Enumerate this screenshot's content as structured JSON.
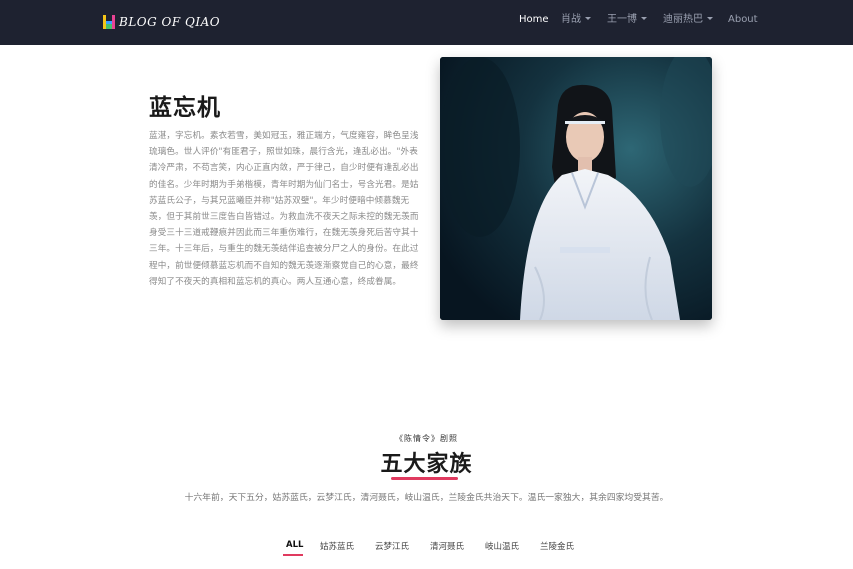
{
  "navbar": {
    "brand": "BLOG OF QIAO",
    "items": [
      {
        "label": "Home",
        "active": true,
        "dropdown": false
      },
      {
        "label": "肖战",
        "active": false,
        "dropdown": true
      },
      {
        "label": "王一博",
        "active": false,
        "dropdown": true
      },
      {
        "label": "迪丽热巴",
        "active": false,
        "dropdown": true
      },
      {
        "label": "About",
        "active": false,
        "dropdown": false
      }
    ]
  },
  "hero": {
    "title": "蓝忘机",
    "description": "蓝湛，字忘机。素衣若雪，美如冠玉，雅正端方，气度雍容，眸色呈浅琉璃色。世人评价\"有匪君子，照世如珠，晨行含光，逢乱必出。\"外表清冷严肃，不苟言笑，内心正直内敛，严于律己，自少时便有逢乱必出的佳名。少年时期为手弟楷模，青年时期为仙门名士，号含光君。是姑苏蓝氏公子，与其兄蓝曦臣并称\"姑苏双璧\"。年少时便暗中倾慕魏无羡，但于其前世三度告白皆错过。为救血洗不夜天之际未控的魏无羡而身受三十三道戒鞭痕并因此而三年重伤难行，在魏无羡身死后苦守其十三年。十三年后，与重生的魏无羡结伴追查被分尸之人的身份。在此过程中，前世便倾慕蓝忘机而不自知的魏无羡逐渐察觉自己的心意，最终得知了不夜天的真相和蓝忘机的真心。两人互通心意，终成眷属。",
    "image": "portrait-photo"
  },
  "section": {
    "kicker": "《陈情令》剧照",
    "title": "五大家族",
    "description": "十六年前，天下五分，姑苏蓝氏，云梦江氏，清河聂氏，岐山温氏，兰陵金氏共治天下。温氏一家独大，其余四家均受其苦。",
    "filters": [
      "ALL",
      "姑苏蓝氏",
      "云梦江氏",
      "清河聂氏",
      "岐山温氏",
      "兰陵金氏"
    ],
    "active_filter": "ALL"
  },
  "colors": {
    "navbar_bg": "#1e2230",
    "accent": "#e03a5f"
  }
}
